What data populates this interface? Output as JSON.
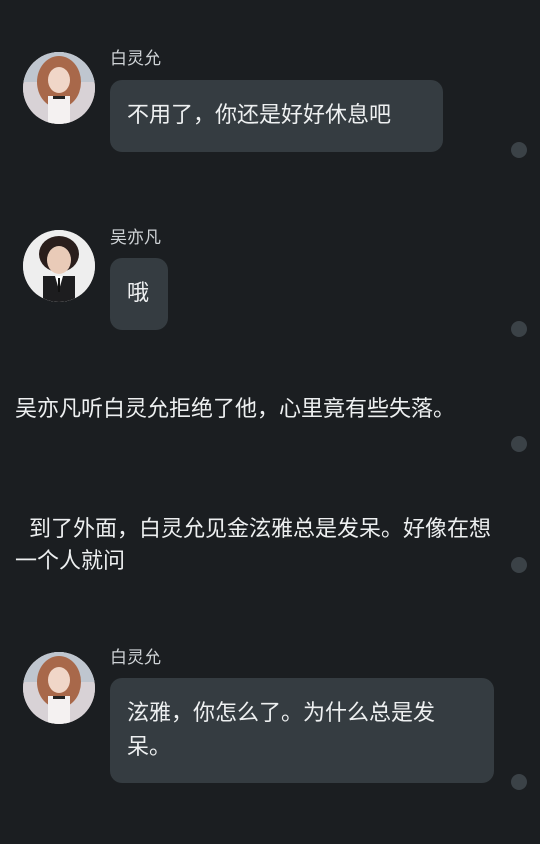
{
  "messages": [
    {
      "sender": "白灵允",
      "text": "不用了，你还是好好休息吧"
    },
    {
      "sender": "吴亦凡",
      "text": "哦"
    },
    {
      "narration": "吴亦凡听白灵允拒绝了他，心里竟有些失落。"
    },
    {
      "narration": "  到了外面，白灵允见金泫雅总是发呆。好像在想一个人就问"
    },
    {
      "sender": "白灵允",
      "text": "泫雅，你怎么了。为什么总是发呆。"
    }
  ],
  "colors": {
    "background": "#1b1e21",
    "bubble": "#353c41",
    "dot": "#3b4247",
    "text": "#eef0f1"
  }
}
